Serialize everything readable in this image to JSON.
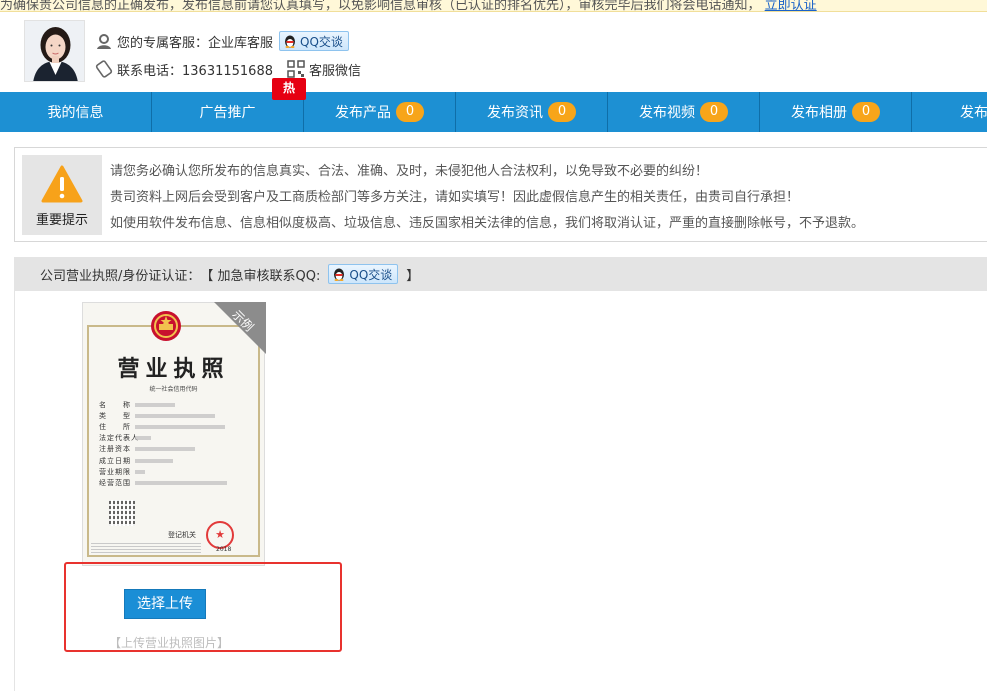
{
  "top_notice": {
    "text": "为确保贵公司信息的正确发布，发布信息前请您认真填写，以免影响信息审核（已认证的排名优先），审核完毕后我们将会电话通知，",
    "link_label": "立即认证"
  },
  "service": {
    "label": "您的专属客服：企业库客服",
    "qq_button": "QQ交谈",
    "phone_label": "联系电话：13631151688",
    "wechat_label": "客服微信",
    "hot_badge": "热"
  },
  "nav": {
    "items": [
      {
        "label": "我的信息",
        "badge": null
      },
      {
        "label": "广告推广",
        "badge": null
      },
      {
        "label": "发布产品",
        "badge": "0"
      },
      {
        "label": "发布资讯",
        "badge": "0"
      },
      {
        "label": "发布视频",
        "badge": "0"
      },
      {
        "label": "发布相册",
        "badge": "0"
      },
      {
        "label": "发布画册",
        "badge": null
      }
    ]
  },
  "notice": {
    "icon_label": "重要提示",
    "lines": [
      "请您务必确认您所发布的信息真实、合法、准确、及时，未侵犯他人合法权利，以免导致不必要的纠纷！",
      "贵司资料上网后会受到客户及工商质检部门等多方关注，请如实填写！因此虚假信息产生的相关责任，由贵司自行承担！",
      "如使用软件发布信息、信息相似度极高、垃圾信息、违反国家相关法律的信息，我们将取消认证，严重的直接删除帐号，不予退款。"
    ]
  },
  "certification": {
    "label": "公司营业执照/身份证认证：",
    "bracket_open": "【 加急审核联系QQ:",
    "qq_button": "QQ交谈",
    "bracket_close": "】",
    "sample_ribbon": "示例",
    "license": {
      "title": "营业执照",
      "code_label": "统一社会信用代码",
      "fields": [
        "名　　称",
        "类　　型",
        "住　　所",
        "法定代表人",
        "注册资本",
        "成立日期",
        "营业期限",
        "经营范围"
      ],
      "registry_label": "登记机关",
      "year": "2018"
    },
    "upload_button": "选择上传",
    "upload_hint": "【上传营业执照图片】"
  },
  "colors": {
    "nav_bg": "#1d90d3",
    "badge": "#f7a51a",
    "hot": "#e60012",
    "upload_button": "#1a8ed6",
    "highlight_border": "#e8322e"
  }
}
